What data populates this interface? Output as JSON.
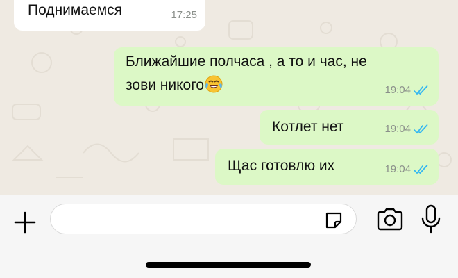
{
  "chat": {
    "messages": [
      {
        "direction": "incoming",
        "text": "Поднимаемся",
        "time": "17:25"
      },
      {
        "direction": "outgoing",
        "line1": "Ближайшие полчаса , а то и час, не",
        "line2": "зови никого",
        "emoji": "face-with-tears-of-joy",
        "time": "19:04",
        "status": "read"
      },
      {
        "direction": "outgoing",
        "text": "Котлет нет",
        "time": "19:04",
        "status": "read"
      },
      {
        "direction": "outgoing",
        "text": "Щас готовлю их",
        "time": "19:04",
        "status": "read"
      }
    ]
  },
  "input_bar": {
    "message_value": "",
    "icons": [
      "plus-icon",
      "sticker-icon",
      "camera-icon",
      "microphone-icon"
    ]
  },
  "colors": {
    "chat_background": "#efeae2",
    "incoming_bubble": "#ffffff",
    "outgoing_bubble": "#dcf8c6",
    "read_ticks": "#34b7f1",
    "timestamp": "#8a8f8a"
  }
}
